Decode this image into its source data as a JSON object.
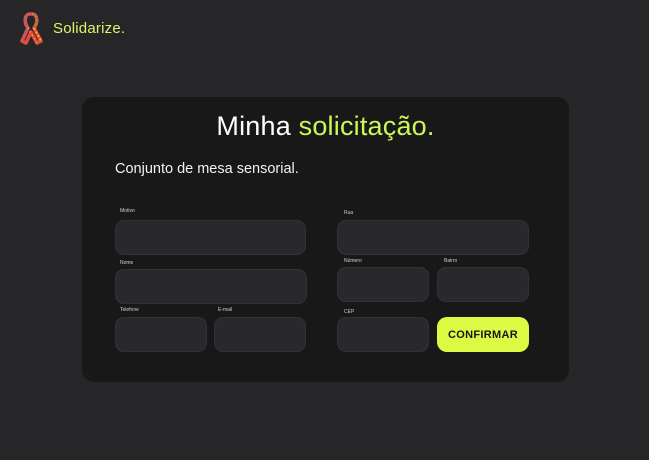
{
  "header": {
    "brand_name": "Solidarize."
  },
  "card": {
    "title_main": "Minha",
    "title_accent": "solicitação.",
    "subtitle": "Conjunto de mesa sensorial."
  },
  "form": {
    "motivo": {
      "label": "Motivo",
      "value": ""
    },
    "nome": {
      "label": "Nome",
      "value": ""
    },
    "telefone": {
      "label": "Telefone",
      "value": ""
    },
    "email": {
      "label": "E-mail",
      "value": ""
    },
    "rua": {
      "label": "Rua",
      "value": ""
    },
    "numero": {
      "label": "Número",
      "value": ""
    },
    "bairro": {
      "label": "Bairro",
      "value": ""
    },
    "cep": {
      "label": "CEP",
      "value": ""
    },
    "confirm_label": "CONFIRMAR"
  },
  "colors": {
    "accent": "#cdf65b",
    "button": "#dcfa43",
    "page_bg": "#262528",
    "card_bg": "#181818",
    "field_bg": "#29292d"
  },
  "icons": {
    "logo": "awareness-ribbon-icon"
  }
}
